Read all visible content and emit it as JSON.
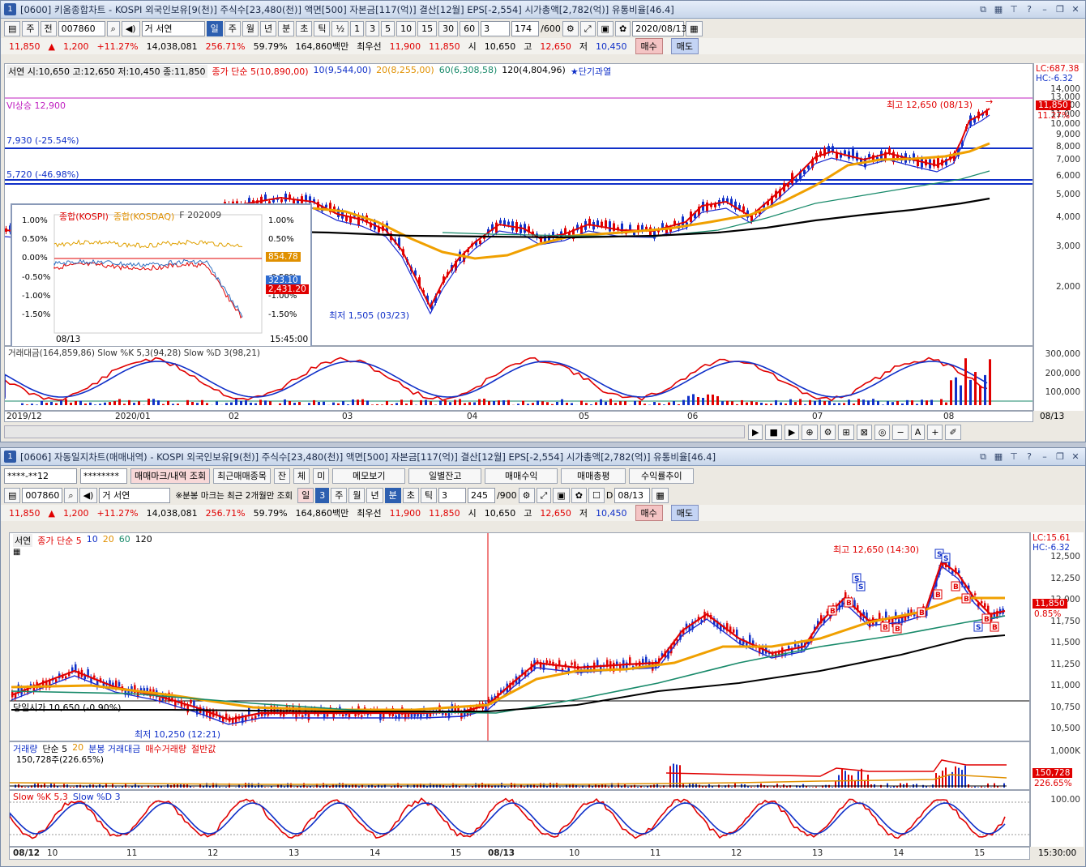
{
  "top": {
    "title": "[0600] 키움종합차트 - KOSPI 외국인보유[9(천)] 주식수[23,480(천)] 액면[500] 자본금[117(억)] 결산[12월] EPS[-2,554] 시가총액[2,782(억)] 유통비율[46.4]",
    "win_num": "1",
    "toolbar": {
      "period_type": "주",
      "adj": "전",
      "code": "007860",
      "name": "거 서연",
      "tabs": [
        "일",
        "주",
        "월",
        "년",
        "분",
        "초",
        "틱"
      ],
      "half": "½",
      "intervals": [
        "1",
        "3",
        "5",
        "10",
        "15",
        "30",
        "60"
      ],
      "interval_sel": "3",
      "count": "174",
      "count_max": "/600",
      "date": "2020/08/13"
    },
    "quote": {
      "price": "11,850",
      "change": "1,200",
      "pct": "+11.27%",
      "volume": "14,038,081",
      "vol_ratio": "256.71%",
      "turnover": "59.79%",
      "amount": "164,860백만",
      "best_label": "최우선",
      "ask": "11,900",
      "bid": "11,850",
      "open_label": "시",
      "open": "10,650",
      "high_label": "고",
      "high": "12,650",
      "low_label": "저",
      "low": "10,450",
      "buy": "매수",
      "sell": "매도"
    },
    "legend": {
      "ohlc": "서연 시:10,650 고:12,650 저:10,450 종:11,850",
      "ma_title": "종가 단순 5(10,890,00)",
      "ma10": "10(9,544,00)",
      "ma20": "20(8,255,00)",
      "ma60": "60(6,308,58)",
      "ma120": "120(4,804,96)",
      "star": "★단기과열"
    },
    "lc": "LC:687.38",
    "hc": "HC:-6.32",
    "annot_vi": "VI상승 12,900",
    "annot_line1": "7,930 (-25.54%)",
    "annot_line2": "5,720 (-46.98%)",
    "annot_high": "최고 12,650 (08/13)",
    "annot_low": "최저 1,505 (03/23)",
    "price_box": "11,850",
    "pct_box": "11.27%",
    "yticks": [
      "14,000",
      "13,000",
      "12,000",
      "11,000",
      "10,000",
      "9,000",
      "8,000",
      "7,000",
      "6,000",
      "5,000",
      "4,000",
      "3,000",
      "2,000"
    ],
    "sub_legend": "거래대금(164,859,86)  Slow %K 5,3(94,28)  Slow %D 3(98,21)",
    "sub_yticks": [
      "300,000",
      "200,000",
      "100,000"
    ],
    "xlabels": [
      "2019/12",
      "2020/01",
      "02",
      "03",
      "04",
      "05",
      "06",
      "07",
      "08"
    ],
    "x_end": "08/13",
    "inset": {
      "leg1": "종합(KOSPI)",
      "leg2": "종합(KOSDAQ)",
      "leg3": "F 202009",
      "yl": [
        "1.00%",
        "0.50%",
        "0.00%",
        "-0.50%",
        "-1.00%",
        "-1.50%"
      ],
      "yr": [
        "1.00%",
        "0.50%",
        "0.00%",
        "-0.50%",
        "-1.00%",
        "-1.50%"
      ],
      "box1": "854.78",
      "box2": "323.10",
      "box3": "2,431.20",
      "date": "08/13",
      "time": "15:45:00"
    }
  },
  "bottom": {
    "title": "[0606] 자동일지차트(매매내역) - KOSPI 외국인보유[9(천)] 주식수[23,480(천)] 액면[500] 자본금[117(억)] 결산[12월] EPS[-2,554] 시가총액[2,782(억)] 유통비율[46.4]",
    "win_num": "1",
    "toolbar1": {
      "account": "****-**12",
      "password": "********",
      "b1": "매매마크/내역 조회",
      "b2": "최근매매종목",
      "b3": "잔",
      "b4": "체",
      "b5": "미",
      "b6": "메모보기",
      "b7": "일별잔고",
      "b8": "매매수익",
      "b9": "매매총평",
      "b10": "수익률추이"
    },
    "toolbar2": {
      "code": "007860",
      "name": "거 서연",
      "note": "※분봉 마크는 최근 2개월만 조회",
      "tabs": [
        "일",
        "3",
        "주",
        "월",
        "년",
        "분",
        "초",
        "틱"
      ],
      "interval": "3",
      "count": "245",
      "count_max": "/900",
      "d_label": "D",
      "date": "08/13"
    },
    "quote": {
      "price": "11,850",
      "change": "1,200",
      "pct": "+11.27%",
      "volume": "14,038,081",
      "vol_ratio": "256.71%",
      "turnover": "59.79%",
      "amount": "164,860백만",
      "best_label": "최우선",
      "ask": "11,900",
      "bid": "11,850",
      "open_label": "시",
      "open": "10,650",
      "high_label": "고",
      "high": "12,650",
      "low_label": "저",
      "low": "10,450",
      "buy": "매수",
      "sell": "매도"
    },
    "legend": {
      "name": "서연",
      "ma": "종가 단순 5",
      "m10": "10",
      "m20": "20",
      "m60": "60",
      "m120": "120"
    },
    "lc": "LC:15.61",
    "hc": "HC:-6.32",
    "annot_high": "최고 12,650 (14:30)",
    "annot_low": "최저 10,250 (12:21)",
    "annot_open": "당일시가 10,650 (-0.90%)",
    "price_box": "11,850",
    "pct_box": "0.85%",
    "yticks": [
      "12,500",
      "12,250",
      "12,000",
      "11,750",
      "11,500",
      "11,250",
      "11,000",
      "10,750",
      "10,500"
    ],
    "vol_legend": {
      "a": "거래량",
      "b": "단순 5",
      "c": "20",
      "d": "분봉 거래대금",
      "e": "매수거래량",
      "f": "절반값"
    },
    "vol_note": "150,728주(226.65%)",
    "vol_yticks": [
      "1,000K"
    ],
    "vol_box1": "150,728",
    "vol_box2": "226.65%",
    "stoch_legend": {
      "a": "Slow %K 5,3",
      "b": "Slow %D 3"
    },
    "stoch_ytick": "100.00",
    "xlabels": [
      "08/12",
      "10",
      "11",
      "12",
      "13",
      "14",
      "15",
      "08/13",
      "10",
      "11",
      "12",
      "13",
      "14",
      "15"
    ],
    "x_end": "15:30:00"
  },
  "colors": {
    "up": "#e00000",
    "down": "#1030c8",
    "ma5": "#e00000",
    "ma10": "#1a2ad0",
    "ma20": "#f0a000",
    "ma60": "#188a6a",
    "ma120": "#000000"
  }
}
